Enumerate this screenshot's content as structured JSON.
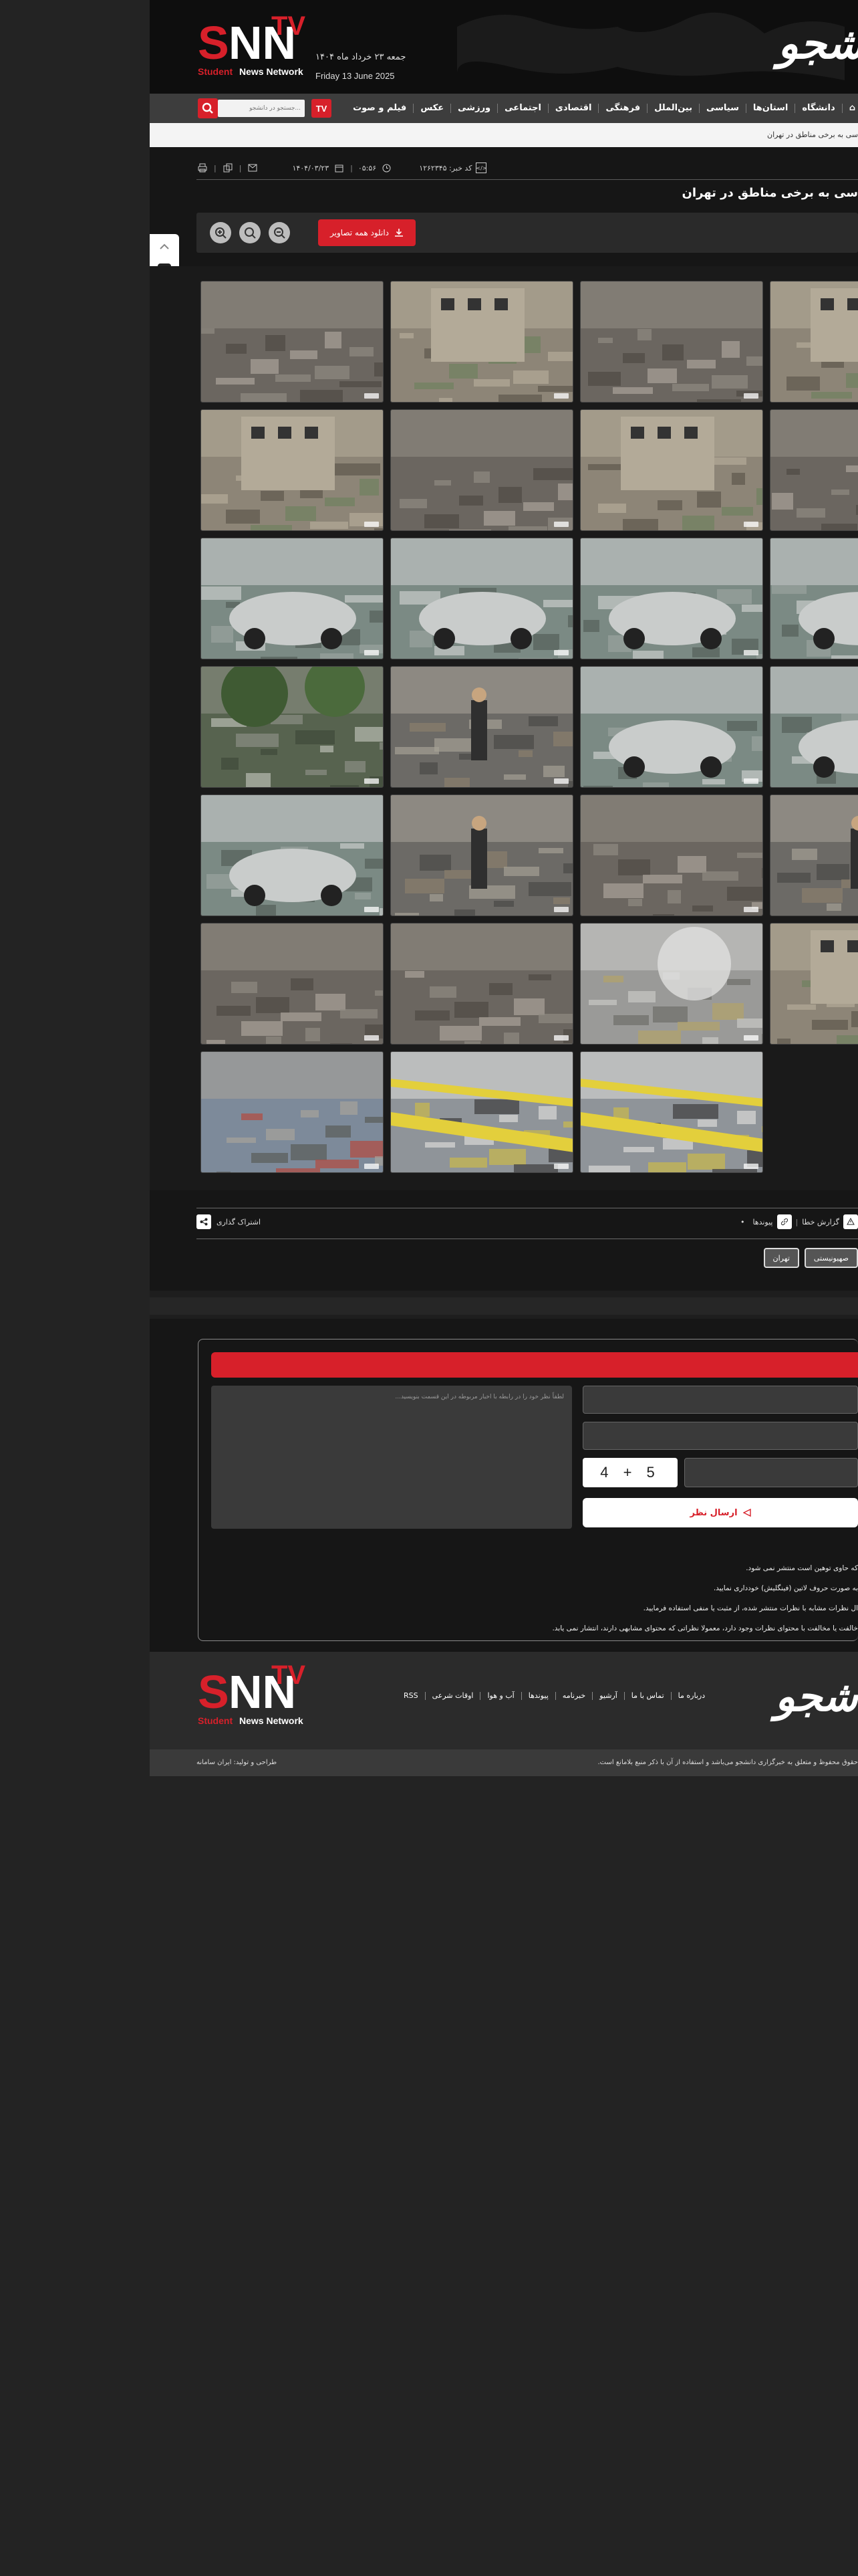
{
  "header": {
    "logo_text": "SNN",
    "logo_tv": "TV",
    "logo_tagline_student": "Student",
    "logo_tagline_rest": "News Network",
    "date_fa": "جمعه ۲۳ خرداد ماه ۱۴۰۴",
    "date_en": "Friday 13 June 2025",
    "brand": "شجو"
  },
  "nav": {
    "search_placeholder": "جستجو در دانشجو...",
    "tv_label": "TV",
    "items": [
      "دانشگاه",
      "استان‌ها",
      "سیاسی",
      "بین‌الملل",
      "فرهنگی",
      "اقتصادی",
      "اجتماعی",
      "ورزشی",
      "عکس",
      "فیلم و صوت"
    ]
  },
  "ticker": {
    "text": "سی به برخی مناطق در تهران"
  },
  "meta": {
    "news_code": "کد خبر: ۱۲۶۲۳۴۵",
    "time": "۰۵:۵۶",
    "date": "۱۴۰۴/۰۳/۲۳"
  },
  "article": {
    "title": "سی به برخی مناطق در تهران"
  },
  "toolbar": {
    "download_all": "دانلود همه تصاویر"
  },
  "gallery": {
    "photos": [
      {
        "name": "photo-1",
        "theme": "rubble"
      },
      {
        "name": "photo-2",
        "theme": "building"
      },
      {
        "name": "photo-3",
        "theme": "rubble"
      },
      {
        "name": "photo-4",
        "theme": "building"
      },
      {
        "name": "photo-5",
        "theme": "building"
      },
      {
        "name": "photo-6",
        "theme": "rubble"
      },
      {
        "name": "photo-7",
        "theme": "building"
      },
      {
        "name": "photo-8",
        "theme": "rubble"
      },
      {
        "name": "photo-9",
        "theme": "car"
      },
      {
        "name": "photo-10",
        "theme": "car"
      },
      {
        "name": "photo-11",
        "theme": "car"
      },
      {
        "name": "photo-12",
        "theme": "car"
      },
      {
        "name": "photo-13",
        "theme": "tree"
      },
      {
        "name": "photo-14",
        "theme": "people"
      },
      {
        "name": "photo-15",
        "theme": "car"
      },
      {
        "name": "photo-16",
        "theme": "car"
      },
      {
        "name": "photo-17",
        "theme": "car"
      },
      {
        "name": "photo-18",
        "theme": "people"
      },
      {
        "name": "photo-19",
        "theme": "rubble"
      },
      {
        "name": "photo-20",
        "theme": "people"
      },
      {
        "name": "photo-21",
        "theme": "rubble"
      },
      {
        "name": "photo-22",
        "theme": "rubble"
      },
      {
        "name": "photo-23",
        "theme": "smoke"
      },
      {
        "name": "photo-24",
        "theme": "building"
      },
      {
        "name": "photo-25",
        "theme": "street"
      },
      {
        "name": "photo-26",
        "theme": "tape"
      },
      {
        "name": "photo-27",
        "theme": "tape"
      }
    ]
  },
  "actions": {
    "share_label": "اشتراک گذاری",
    "report_label": "گزارش خطا",
    "links_label": "پیوندها"
  },
  "tags": [
    "تهران",
    "صهیونیستی"
  ],
  "comments": {
    "text_placeholder": "لطفاً نظر خود را در رابطه با اخبار مربوطه در این قسمت بنویسید...",
    "captcha": "4 + 5",
    "submit_label": "ارسال نظر",
    "rules": [
      "که حاوی توهین است منتشر نمی شود.",
      "به صورت حروف لاتین (فینگلیش) خودداری نمایید.",
      "ال نظرات مشابه با نظرات منتشر شده، از مثبت یا منفی استفاده فرمایید.",
      "خالفت یا مخالفت با محتوای نظرات وجود دارد، معمولا نظراتی که محتوای مشابهی دارند، انتشار نمی یابد."
    ]
  },
  "footer": {
    "links": [
      "درباره ما",
      "تماس با ما",
      "آرشیو",
      "خبرنامه",
      "پیوندها",
      "آب و هوا",
      "اوقات شرعی",
      "RSS"
    ],
    "copyright": "حقوق محفوظ و متعلق به خبرگزاری دانشجو می‌باشد و استفاده از آن با ذکر منبع بلامانع است.",
    "credit": "طراحی و تولید: ایران سامانه"
  },
  "colors": {
    "accent": "#d7202a",
    "page_bg": "#161616",
    "outer_bg": "#232323"
  }
}
